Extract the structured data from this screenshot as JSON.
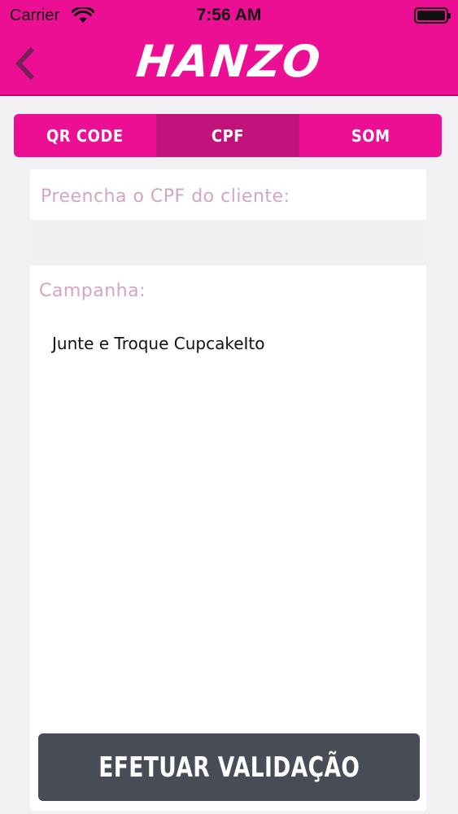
{
  "status_bar": {
    "carrier": "Carrier",
    "time": "7:56 AM"
  },
  "header": {
    "logo_text": "HANZO",
    "back_icon": "chevron-left-icon"
  },
  "tabs": [
    {
      "label": "QR CODE",
      "active": false
    },
    {
      "label": "CPF",
      "active": true
    },
    {
      "label": "SOM",
      "active": false
    }
  ],
  "form": {
    "cpf_label": "Preencha o CPF do cliente:",
    "cpf_value": "",
    "campaign_label": "Campanha:",
    "campaign_value": "Junte e Troque CupcakeIto"
  },
  "action": {
    "submit_label": "EFETUAR VALIDAÇÃO"
  },
  "colors": {
    "brand": "#ec0f94",
    "tab_active": "#c2137d",
    "label": "#d4a6c1",
    "button": "#474c57"
  }
}
